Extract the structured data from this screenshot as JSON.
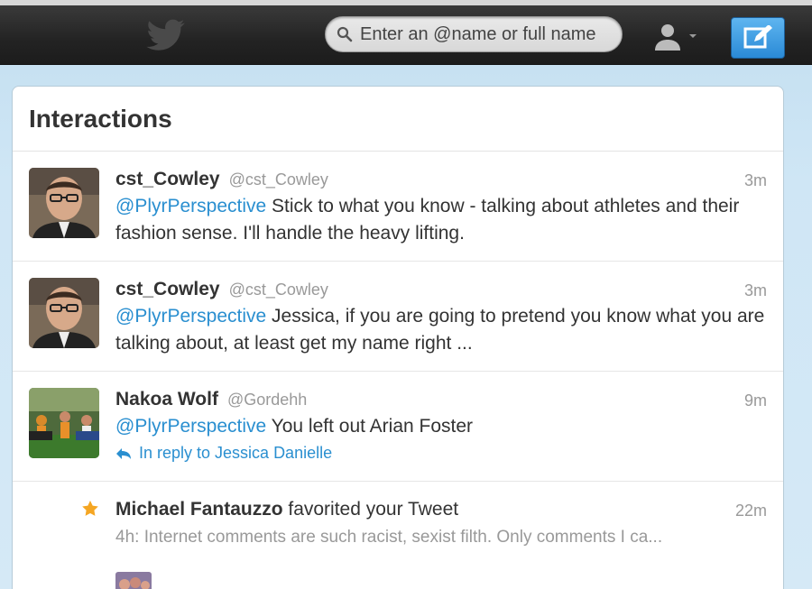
{
  "topbar": {
    "search_placeholder": "Enter an @name or full name"
  },
  "panel": {
    "title": "Interactions"
  },
  "tweets": [
    {
      "name": "cst_Cowley",
      "handle": "@cst_Cowley",
      "time": "3m",
      "mention": "@PlyrPerspective",
      "text": " Stick to what you know - talking about athletes and their fashion sense. I'll handle the heavy lifting."
    },
    {
      "name": "cst_Cowley",
      "handle": "@cst_Cowley",
      "time": "3m",
      "mention": "@PlyrPerspective",
      "text": " Jessica, if you are going to pretend you know what you are talking about, at least get my name right ..."
    },
    {
      "name": "Nakoa Wolf",
      "handle": "@Gordehh",
      "time": "9m",
      "mention": "@PlyrPerspective",
      "text": " You left out Arian Foster",
      "reply": "In reply to Jessica Danielle"
    }
  ],
  "favorite": {
    "name": "Michael Fantauzzo",
    "action": " favorited your Tweet",
    "time": "22m",
    "snippet": "4h: Internet comments are such racist, sexist filth. Only comments I ca..."
  },
  "colors": {
    "link": "#2a8fd0",
    "star": "#f5a623",
    "compose": "#2a8ad6"
  }
}
